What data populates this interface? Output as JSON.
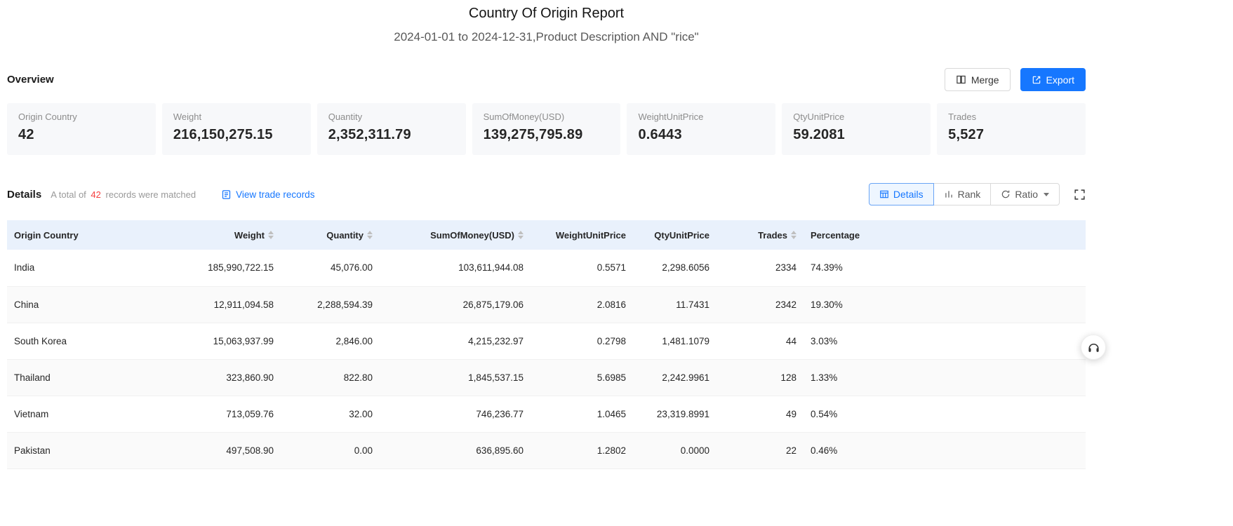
{
  "report": {
    "title": "Country Of Origin Report",
    "subtitle": "2024-01-01 to 2024-12-31,Product Description AND \"rice\""
  },
  "overview": {
    "heading": "Overview",
    "merge_button": "Merge",
    "export_button": "Export",
    "cards": [
      {
        "label": "Origin Country",
        "value": "42"
      },
      {
        "label": "Weight",
        "value": "216,150,275.15"
      },
      {
        "label": "Quantity",
        "value": "2,352,311.79"
      },
      {
        "label": "SumOfMoney(USD)",
        "value": "139,275,795.89"
      },
      {
        "label": "WeightUnitPrice",
        "value": "0.6443"
      },
      {
        "label": "QtyUnitPrice",
        "value": "59.2081"
      },
      {
        "label": "Trades",
        "value": "5,527"
      }
    ]
  },
  "details": {
    "heading": "Details",
    "match_prefix": "A total of",
    "match_count": "42",
    "match_suffix": "records were matched",
    "view_link": "View trade records",
    "tab_details": "Details",
    "tab_rank": "Rank",
    "tab_ratio": "Ratio"
  },
  "table": {
    "headers": [
      "Origin Country",
      "Weight",
      "Quantity",
      "SumOfMoney(USD)",
      "WeightUnitPrice",
      "QtyUnitPrice",
      "Trades",
      "Percentage"
    ],
    "rows": [
      [
        "India",
        "185,990,722.15",
        "45,076.00",
        "103,611,944.08",
        "0.5571",
        "2,298.6056",
        "2334",
        "74.39%"
      ],
      [
        "China",
        "12,911,094.58",
        "2,288,594.39",
        "26,875,179.06",
        "2.0816",
        "11.7431",
        "2342",
        "19.30%"
      ],
      [
        "South Korea",
        "15,063,937.99",
        "2,846.00",
        "4,215,232.97",
        "0.2798",
        "1,481.1079",
        "44",
        "3.03%"
      ],
      [
        "Thailand",
        "323,860.90",
        "822.80",
        "1,845,537.15",
        "5.6985",
        "2,242.9961",
        "128",
        "1.33%"
      ],
      [
        "Vietnam",
        "713,059.76",
        "32.00",
        "746,236.77",
        "1.0465",
        "23,319.8991",
        "49",
        "0.54%"
      ],
      [
        "Pakistan",
        "497,508.90",
        "0.00",
        "636,895.60",
        "1.2802",
        "0.0000",
        "22",
        "0.46%"
      ]
    ]
  },
  "colors": {
    "accent_blue": "#1677ff",
    "count_red": "#f53f3f",
    "table_header_bg": "#e9f1fc",
    "card_bg": "#f7f8fa"
  }
}
